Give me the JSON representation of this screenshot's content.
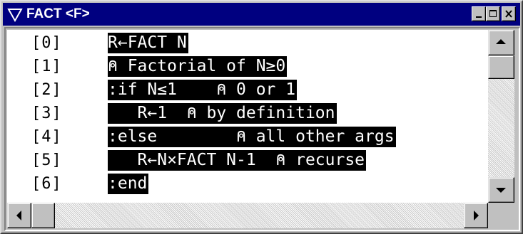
{
  "window": {
    "title": "FACT <F>",
    "title_icon": "dropdown-triangle-icon",
    "controls": [
      "minimize-icon",
      "maximize-icon",
      "close-icon"
    ]
  },
  "editor": {
    "lines": [
      {
        "number": "[0]",
        "code": "R←FACT N"
      },
      {
        "number": "[1]",
        "code": "⍝ Factorial of N≥0"
      },
      {
        "number": "[2]",
        "code": ":if N≤1    ⍝ 0 or 1"
      },
      {
        "number": "[3]",
        "code": "   R←1  ⍝ by definition"
      },
      {
        "number": "[4]",
        "code": ":else        ⍝ all other args"
      },
      {
        "number": "[5]",
        "code": "   R←N×FACT N-1  ⍝ recurse"
      },
      {
        "number": "[6]",
        "code": ":end"
      }
    ]
  },
  "colors": {
    "titlebar": "#000080",
    "selection": "#000000",
    "face": "#c0c0c0"
  }
}
